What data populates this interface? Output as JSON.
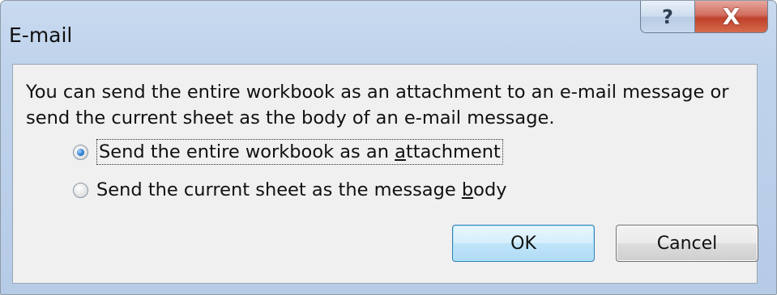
{
  "window": {
    "title": "E-mail",
    "help_glyph": "?",
    "close_glyph": "X"
  },
  "dialog": {
    "message": "You can send the entire workbook as an attachment to an e-mail message or send the current sheet as the body of an e-mail message.",
    "options": [
      {
        "label_before": "Send the entire workbook as an ",
        "mnemonic": "a",
        "label_after": "ttachment",
        "selected": true,
        "focused": true
      },
      {
        "label_before": "Send the current sheet as the message ",
        "mnemonic": "b",
        "label_after": "ody",
        "selected": false,
        "focused": false
      }
    ],
    "ok_label": "OK",
    "cancel_label": "Cancel"
  },
  "icons": {
    "help": "help-icon",
    "close": "close-icon"
  },
  "colors": {
    "frame": "#bfd3ec",
    "close_button": "#c0412b",
    "default_button": "#bfe4f9",
    "radio_selected": "#2c7fd6"
  }
}
